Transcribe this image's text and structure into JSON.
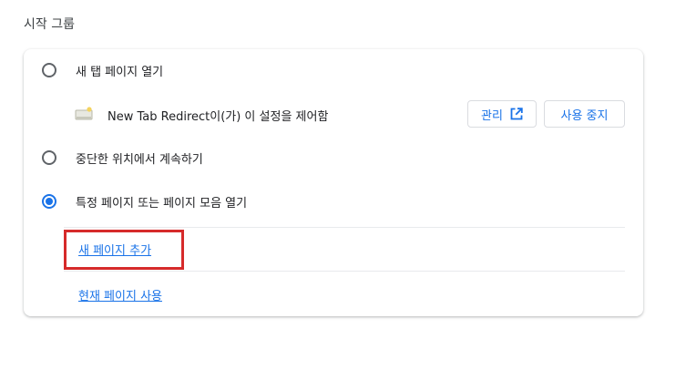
{
  "section": {
    "title": "시작 그룹"
  },
  "options": {
    "new_tab": {
      "label": "새 탭 페이지 열기",
      "checked": false
    },
    "continue": {
      "label": "중단한 위치에서 계속하기",
      "checked": false
    },
    "specific": {
      "label": "특정 페이지 또는 페이지 모음 열기",
      "checked": true
    }
  },
  "extension": {
    "text": "New Tab Redirect이(가) 이 설정을 제어함",
    "icon": "extension-puzzle-icon",
    "manage_label": "관리",
    "manage_icon": "open-in-new-icon",
    "stop_label": "사용 중지"
  },
  "links": {
    "add_page": "새 페이지 추가",
    "use_current": "현재 페이지 사용"
  },
  "colors": {
    "accent": "#1a73e8",
    "highlight": "#d62a2a"
  }
}
